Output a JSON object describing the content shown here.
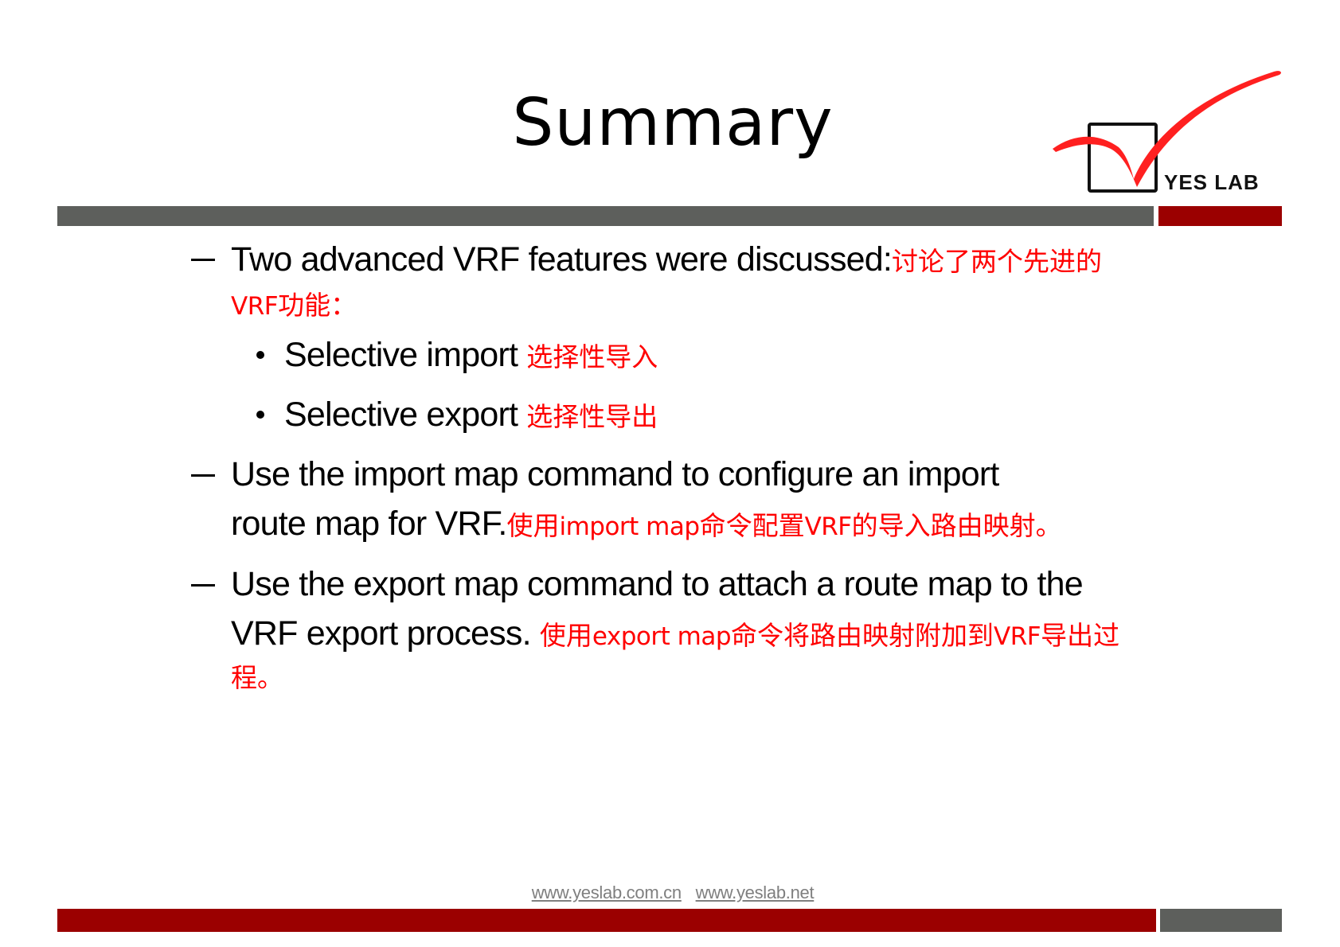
{
  "slide": {
    "title": "Summary",
    "logo": {
      "icon": "checkmark-box-icon",
      "text": "YES LAB",
      "check_color": "#ff2020"
    },
    "colors": {
      "bar_gray": "#5d5f5c",
      "bar_red": "#9b0000",
      "chinese_text": "#ff0000"
    },
    "items": [
      {
        "en": "Two advanced VRF features were discussed:",
        "cn_part1": "讨论了两个先进的",
        "cn_line2_lat": "VRF",
        "cn_line2": "功能："
      }
    ],
    "subitems": [
      {
        "en": "Selective import",
        "cn": "选择性导入"
      },
      {
        "en": "Selective export",
        "cn": "选择性导出"
      }
    ],
    "item2": {
      "en_line1": "Use the import map command to configure an import",
      "en_line2": "route map for VRF.",
      "cn_a": "使用",
      "cn_lat_a": "import map",
      "cn_b": "命令配置",
      "cn_lat_b": "VRF",
      "cn_c": "的导入路由映射。"
    },
    "item3": {
      "en_line1": "Use the export map command to attach a route map to the",
      "en_line2": "VRF export process.",
      "cn_a": "使用",
      "cn_lat_a": "export map",
      "cn_b": "命令将路由映射附加到",
      "cn_lat_b": "VRF",
      "cn_c": "导出过",
      "cn_line3": "程。"
    },
    "footer": {
      "link1": "www.yeslab.com.cn",
      "link2": "www.yeslab.net"
    }
  }
}
